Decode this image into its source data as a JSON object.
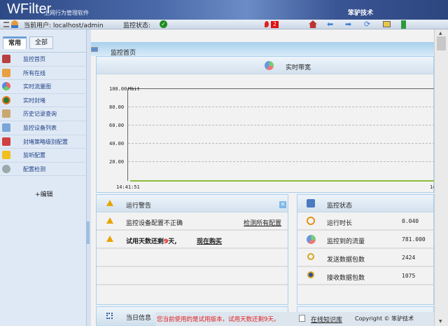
{
  "header": {
    "logo": "WFilter",
    "subtitle": "上网行为管理软件",
    "brand": "笨驴技术"
  },
  "toolbar": {
    "user_label": "当前用户: localhost/admin",
    "status_label": "监控状态:",
    "alert_count": "2"
  },
  "sidebar": {
    "tabs": [
      "常用",
      "全部"
    ],
    "items": [
      "监控首页",
      "所有在线",
      "实时流量图",
      "实时封堵",
      "历史记录查询",
      "监控设备列表",
      "封堵策略级别配置",
      "监听配置",
      "配置检测"
    ],
    "edit": "+编辑"
  },
  "page": {
    "title": "监控首页"
  },
  "bandwidth": {
    "title": "实时带宽",
    "y_ticks": [
      "100.00",
      "80.00",
      "60.00",
      "40.00",
      "20.00"
    ],
    "unit": "Mbit",
    "x_start": "14:41:51",
    "x_end": "14"
  },
  "warnings": {
    "title": "运行警告",
    "rows": [
      {
        "text": "监控设备配置不正确",
        "link": "检测所有配置"
      },
      {
        "text_pre": "试用天数还剩",
        "days": "9",
        "text_post": "天,",
        "link": "现在购买"
      }
    ]
  },
  "status": {
    "title": "监控状态",
    "rows": [
      {
        "label": "运行时长",
        "value": "0.040"
      },
      {
        "label": "监控到的流量",
        "value": "781.000"
      },
      {
        "label": "发送数据包数",
        "value": "2424"
      },
      {
        "label": "接收数据包数",
        "value": "1075"
      }
    ]
  },
  "daily": {
    "title": "当日信息"
  },
  "footer": {
    "trial_notice": "您当前使用的是试用版本，试用天数还剩9天。",
    "kb_link": "在线知识库",
    "copyright": "Copyright ©  笨驴技术"
  }
}
